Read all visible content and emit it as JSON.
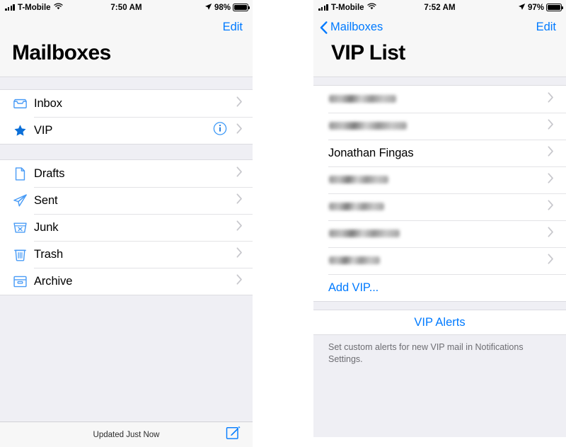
{
  "accent_color": "#007aff",
  "group_bg_color": "#efeff4",
  "left_phone": {
    "status_bar": {
      "carrier": "T-Mobile",
      "time": "7:50 AM",
      "battery_percent": "98%",
      "wifi_icon": "wifi-icon",
      "signal_icon": "signal-bars-icon",
      "location_icon": "location-arrow-icon",
      "battery_icon": "battery-full-icon"
    },
    "nav": {
      "edit_label": "Edit",
      "title": "Mailboxes"
    },
    "mailbox_groups": [
      {
        "items": [
          {
            "label": "Inbox",
            "icon": "inbox-tray-icon",
            "has_info": false
          },
          {
            "label": "VIP",
            "icon": "star-icon",
            "has_info": true
          }
        ]
      },
      {
        "items": [
          {
            "label": "Drafts",
            "icon": "document-icon",
            "has_info": false
          },
          {
            "label": "Sent",
            "icon": "paper-plane-icon",
            "has_info": false
          },
          {
            "label": "Junk",
            "icon": "junk-bin-icon",
            "has_info": false
          },
          {
            "label": "Trash",
            "icon": "trash-icon",
            "has_info": false
          },
          {
            "label": "Archive",
            "icon": "archive-box-icon",
            "has_info": false
          }
        ]
      }
    ],
    "toolbar": {
      "status": "Updated Just Now",
      "compose_icon": "compose-icon"
    }
  },
  "right_phone": {
    "status_bar": {
      "carrier": "T-Mobile",
      "time": "7:52 AM",
      "battery_percent": "97%",
      "wifi_icon": "wifi-icon",
      "signal_icon": "signal-bars-icon",
      "location_icon": "location-arrow-icon",
      "battery_icon": "battery-full-icon"
    },
    "nav": {
      "back_label": "Mailboxes",
      "edit_label": "Edit",
      "title": "VIP List"
    },
    "vip_contacts": [
      {
        "name": "",
        "redacted": true,
        "redacted_width": 95
      },
      {
        "name": "",
        "redacted": true,
        "redacted_width": 110
      },
      {
        "name": "Jonathan Fingas",
        "redacted": false,
        "redacted_width": 0
      },
      {
        "name": "",
        "redacted": true,
        "redacted_width": 84
      },
      {
        "name": "",
        "redacted": true,
        "redacted_width": 78
      },
      {
        "name": "",
        "redacted": true,
        "redacted_width": 100
      },
      {
        "name": "",
        "redacted": true,
        "redacted_width": 72
      }
    ],
    "add_vip_label": "Add VIP...",
    "alerts_label": "VIP Alerts",
    "footer_note": "Set custom alerts for new VIP mail in Notifications Settings."
  }
}
